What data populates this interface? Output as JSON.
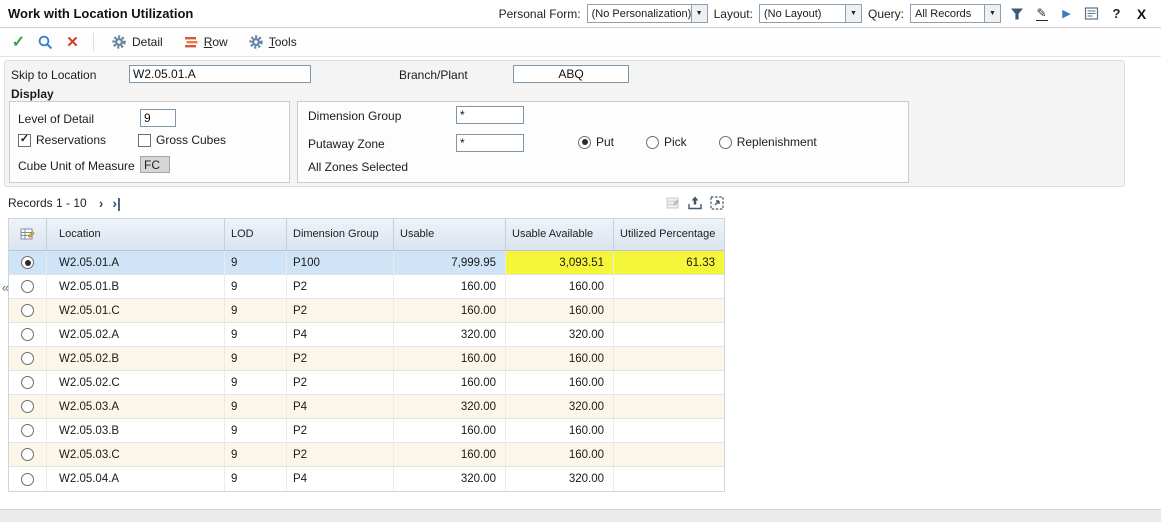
{
  "window": {
    "title": "Work with Location Utilization"
  },
  "header_controls": {
    "personal_form_label": "Personal Form:",
    "personal_form_value": "(No Personalization)",
    "layout_label": "Layout:",
    "layout_value": "(No Layout)",
    "query_label": "Query:",
    "query_value": "All Records"
  },
  "icons": {
    "ok_check": "✓",
    "close_x": "✕",
    "dropdown_arrow": "▼",
    "play": "▶",
    "pencil": "✎",
    "help": "?",
    "window_close": "X",
    "next_page": "›",
    "last_page": "›|",
    "collapse": "«"
  },
  "toolbar": {
    "detail_label": "Detail",
    "row_label": "Row",
    "tools_label": "Tools"
  },
  "form": {
    "skip_to_location": {
      "label": "Skip to Location",
      "value": "W2.05.01.A"
    },
    "branch_plant": {
      "label": "Branch/Plant",
      "value": "ABQ"
    },
    "display_label": "Display",
    "level_of_detail": {
      "label": "Level of Detail",
      "value": "9"
    },
    "reservations": {
      "label": "Reservations",
      "checked": true
    },
    "gross_cubes": {
      "label": "Gross Cubes",
      "checked": false
    },
    "cube_unit_of_measure": {
      "label": "Cube Unit of Measure",
      "value": "FC"
    },
    "dimension_group": {
      "label": "Dimension Group",
      "value": "*"
    },
    "putaway_zone": {
      "label": "Putaway Zone",
      "value": "*"
    },
    "zone_mode": {
      "options": [
        "Put",
        "Pick",
        "Replenishment"
      ],
      "selected": "Put"
    },
    "all_zones_label": "All Zones Selected"
  },
  "colors": {
    "selected_row": "#cfe4f7",
    "row_alternate": "#fbf6e7",
    "cell_highlight": "#f5f53a"
  },
  "grid": {
    "records_label": "Records 1 - 10",
    "columns": [
      "Location",
      "LOD",
      "Dimension Group",
      "Usable",
      "Usable Available",
      "Utilized Percentage"
    ],
    "rows": [
      {
        "location": "W2.05.01.A",
        "lod": "9",
        "dimension_group": "P100",
        "usable": "7,999.95",
        "usable_available": "3,093.51",
        "utilized_percentage": "61.33",
        "selected": true,
        "highlighted": true
      },
      {
        "location": "W2.05.01.B",
        "lod": "9",
        "dimension_group": "P2",
        "usable": "160.00",
        "usable_available": "160.00",
        "utilized_percentage": ""
      },
      {
        "location": "W2.05.01.C",
        "lod": "9",
        "dimension_group": "P2",
        "usable": "160.00",
        "usable_available": "160.00",
        "utilized_percentage": ""
      },
      {
        "location": "W2.05.02.A",
        "lod": "9",
        "dimension_group": "P4",
        "usable": "320.00",
        "usable_available": "320.00",
        "utilized_percentage": ""
      },
      {
        "location": "W2.05.02.B",
        "lod": "9",
        "dimension_group": "P2",
        "usable": "160.00",
        "usable_available": "160.00",
        "utilized_percentage": ""
      },
      {
        "location": "W2.05.02.C",
        "lod": "9",
        "dimension_group": "P2",
        "usable": "160.00",
        "usable_available": "160.00",
        "utilized_percentage": ""
      },
      {
        "location": "W2.05.03.A",
        "lod": "9",
        "dimension_group": "P4",
        "usable": "320.00",
        "usable_available": "320.00",
        "utilized_percentage": ""
      },
      {
        "location": "W2.05.03.B",
        "lod": "9",
        "dimension_group": "P2",
        "usable": "160.00",
        "usable_available": "160.00",
        "utilized_percentage": ""
      },
      {
        "location": "W2.05.03.C",
        "lod": "9",
        "dimension_group": "P2",
        "usable": "160.00",
        "usable_available": "160.00",
        "utilized_percentage": ""
      },
      {
        "location": "W2.05.04.A",
        "lod": "9",
        "dimension_group": "P4",
        "usable": "320.00",
        "usable_available": "320.00",
        "utilized_percentage": ""
      }
    ]
  }
}
